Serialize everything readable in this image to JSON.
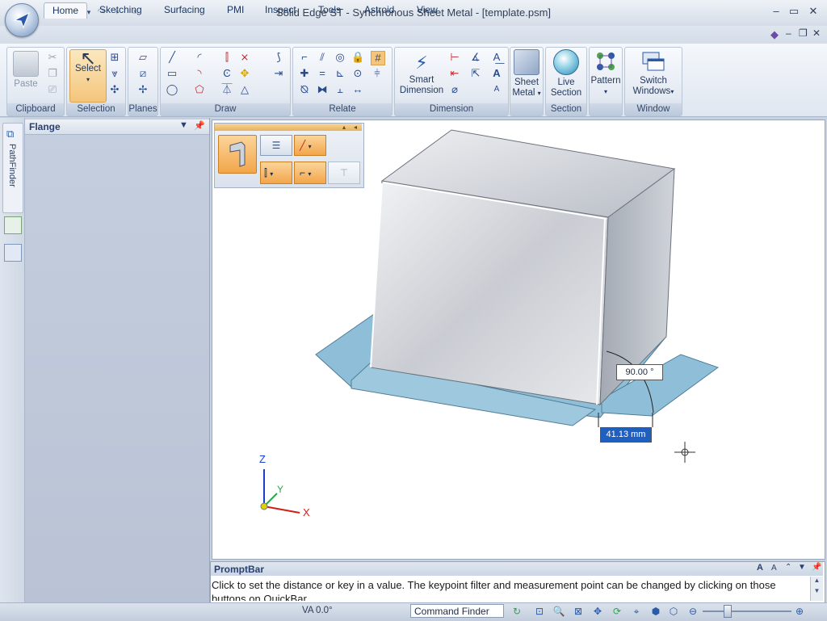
{
  "window": {
    "title": "Solid Edge ST - Synchronous Sheet Metal - [template.psm]"
  },
  "quick_access": {
    "icons": [
      "save-icon",
      "undo-icon",
      "redo-icon",
      "customize-icon"
    ]
  },
  "tabs": [
    {
      "label": "Home",
      "active": true
    },
    {
      "label": "Sketching"
    },
    {
      "label": "Surfacing"
    },
    {
      "label": "PMI"
    },
    {
      "label": "Inspect"
    },
    {
      "label": "Tools"
    },
    {
      "label": "Astroid"
    },
    {
      "label": "View"
    }
  ],
  "ribbon": {
    "groups": {
      "clipboard": "Clipboard",
      "selection": "Selection",
      "planes": "Planes",
      "draw": "Draw",
      "relate": "Relate",
      "dimension": "Dimension",
      "sheet_metal_group": "",
      "section": "Section",
      "pattern_group": "",
      "window": "Window"
    },
    "buttons": {
      "paste": "Paste",
      "select": "Select",
      "smart_dimension_1": "Smart",
      "smart_dimension_2": "Dimension",
      "sheet_metal_1": "Sheet",
      "sheet_metal_2": "Metal",
      "live_section_1": "Live",
      "live_section_2": "Section",
      "pattern": "Pattern",
      "switch_windows_1": "Switch",
      "switch_windows_2": "Windows"
    }
  },
  "pathfinder": {
    "label": "PathFinder"
  },
  "panel": {
    "title": "Flange"
  },
  "viewport": {
    "angle_label": "90.00 °",
    "distance_label": "41.13 mm",
    "axes": {
      "x": "X",
      "y": "Y",
      "z": "Z"
    }
  },
  "promptbar": {
    "title": "PromptBar",
    "text": "Click to set the distance or key in a value. The keypoint filter and measurement point can be changed by clicking on those buttons on QuickBar."
  },
  "statusbar": {
    "status": "VA 0.0°",
    "command_finder": "Command Finder"
  },
  "colors": {
    "ribbon_bg": "#e3e9f2",
    "panel_bg": "#bec8d9",
    "flange_blue": "#8fbfd8",
    "dimension_highlight": "#1f5fbf",
    "quickbar_active": "#f3a54a"
  }
}
